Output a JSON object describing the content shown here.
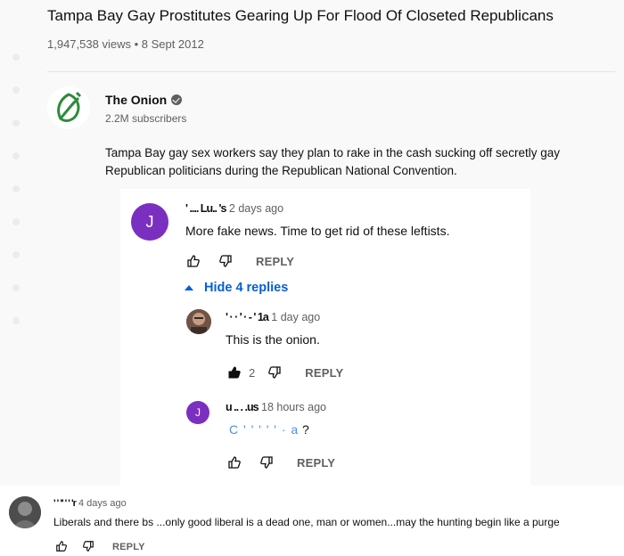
{
  "video": {
    "title": "Tampa Bay Gay Prostitutes Gearing Up For Flood Of Closeted Republicans",
    "meta": "1,947,538 views • 8 Sept 2012"
  },
  "channel": {
    "name": "The Onion",
    "subscribers": "2.2M subscribers",
    "description": "Tampa Bay gay sex workers say they plan to rake in the cash sucking off secretly gay Republican politicians during the Republican National Convention.",
    "logo_color": "#2e8b3a"
  },
  "thread": {
    "top": {
      "avatar_letter": "J",
      "author": "' .... Lu.. 's",
      "time": "2 days ago",
      "text": "More fake news.  Time to get rid of these leftists.",
      "reply_label": "REPLY"
    },
    "hide_replies_label": "Hide 4 replies",
    "replies": [
      {
        "author": "' · · ' · - ' 1a",
        "time": "1 day ago",
        "text": "This is the onion.",
        "likes": "2",
        "reply_label": "REPLY"
      },
      {
        "avatar_letter": "J",
        "author": "u .. . .us",
        "time": "18 hours ago",
        "mention": "C '  ' ' ' ' · a",
        "text": " ?",
        "reply_label": "REPLY"
      }
    ]
  },
  "bottom_comment": {
    "author": "' ' '' ' ' 'r",
    "time": "4 days ago",
    "text": "Liberals and there bs ...only good liberal is a dead one, man or women...may the hunting begin like a purge",
    "reply_label": "REPLY"
  },
  "colors": {
    "accent_link": "#065fd4",
    "avatar_purple": "#7b2fc1"
  }
}
